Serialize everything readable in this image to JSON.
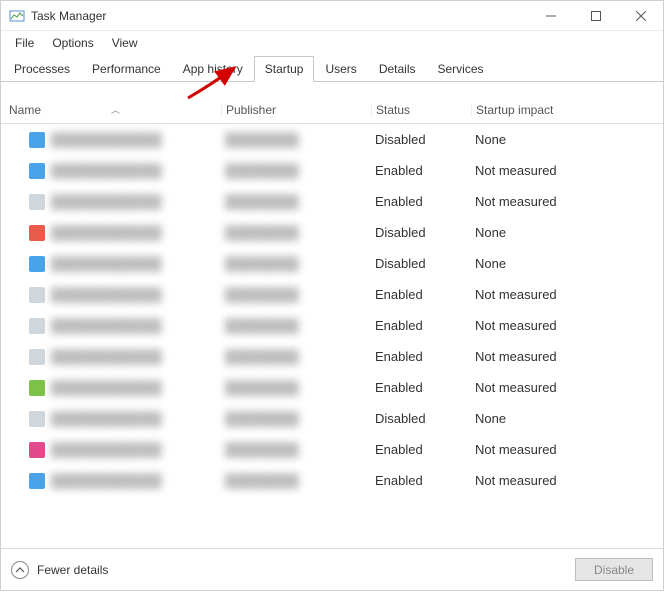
{
  "titlebar": {
    "title": "Task Manager"
  },
  "menubar": {
    "file": "File",
    "options": "Options",
    "view": "View"
  },
  "tabs": {
    "processes": "Processes",
    "performance": "Performance",
    "app_history": "App history",
    "startup": "Startup",
    "users": "Users",
    "details": "Details",
    "services": "Services"
  },
  "columns": {
    "name": "Name",
    "publisher": "Publisher",
    "status": "Status",
    "impact": "Startup impact"
  },
  "rows": [
    {
      "icon_color": "#4aa3e8",
      "status": "Disabled",
      "impact": "None"
    },
    {
      "icon_color": "#4aa3e8",
      "status": "Enabled",
      "impact": "Not measured"
    },
    {
      "icon_color": "#cfd6dc",
      "status": "Enabled",
      "impact": "Not measured"
    },
    {
      "icon_color": "#e85a4a",
      "status": "Disabled",
      "impact": "None"
    },
    {
      "icon_color": "#4aa3e8",
      "status": "Disabled",
      "impact": "None"
    },
    {
      "icon_color": "#cfd6dc",
      "status": "Enabled",
      "impact": "Not measured"
    },
    {
      "icon_color": "#cfd6dc",
      "status": "Enabled",
      "impact": "Not measured"
    },
    {
      "icon_color": "#cfd6dc",
      "status": "Enabled",
      "impact": "Not measured"
    },
    {
      "icon_color": "#7cc24a",
      "status": "Enabled",
      "impact": "Not measured"
    },
    {
      "icon_color": "#cfd6dc",
      "status": "Disabled",
      "impact": "None"
    },
    {
      "icon_color": "#e24a8b",
      "status": "Enabled",
      "impact": "Not measured"
    },
    {
      "icon_color": "#4aa3e8",
      "status": "Enabled",
      "impact": "Not measured"
    }
  ],
  "footer": {
    "fewer": "Fewer details",
    "disable": "Disable"
  },
  "arrow_color": "#d20000"
}
